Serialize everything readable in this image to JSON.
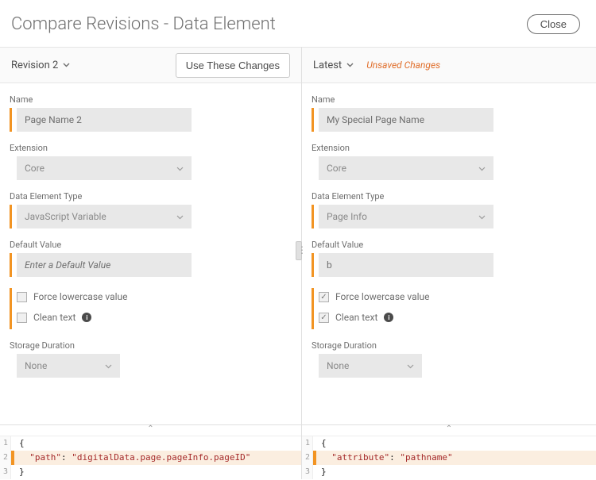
{
  "title": "Compare Revisions - Data Element",
  "close_label": "Close",
  "left": {
    "revision_label": "Revision 2",
    "use_changes_label": "Use These Changes",
    "fields": {
      "name_label": "Name",
      "name_value": "Page Name 2",
      "extension_label": "Extension",
      "extension_value": "Core",
      "type_label": "Data Element Type",
      "type_value": "JavaScript Variable",
      "default_label": "Default Value",
      "default_placeholder": "Enter a Default Value",
      "force_lower_label": "Force lowercase value",
      "clean_text_label": "Clean text",
      "storage_label": "Storage Duration",
      "storage_value": "None"
    },
    "code": {
      "lines": [
        {
          "n": "1",
          "text": "{",
          "changed": false
        },
        {
          "n": "2",
          "text_html": "  <span class=\"tok-key\">\"path\"</span>: <span class=\"tok-str\">\"digitalData.page.pageInfo.pageID\"</span>",
          "changed": true
        },
        {
          "n": "3",
          "text": "}",
          "changed": false
        }
      ]
    }
  },
  "right": {
    "revision_label": "Latest",
    "unsaved_label": "Unsaved Changes",
    "fields": {
      "name_label": "Name",
      "name_value": "My Special Page Name",
      "extension_label": "Extension",
      "extension_value": "Core",
      "type_label": "Data Element Type",
      "type_value": "Page Info",
      "default_label": "Default Value",
      "default_value": "b",
      "force_lower_label": "Force lowercase value",
      "clean_text_label": "Clean text",
      "storage_label": "Storage Duration",
      "storage_value": "None"
    },
    "code": {
      "lines": [
        {
          "n": "1",
          "text": "{",
          "changed": false
        },
        {
          "n": "2",
          "text_html": "  <span class=\"tok-key\">\"attribute\"</span>: <span class=\"tok-str\">\"pathname\"</span>",
          "changed": true
        },
        {
          "n": "3",
          "text": "}",
          "changed": false
        }
      ]
    }
  }
}
